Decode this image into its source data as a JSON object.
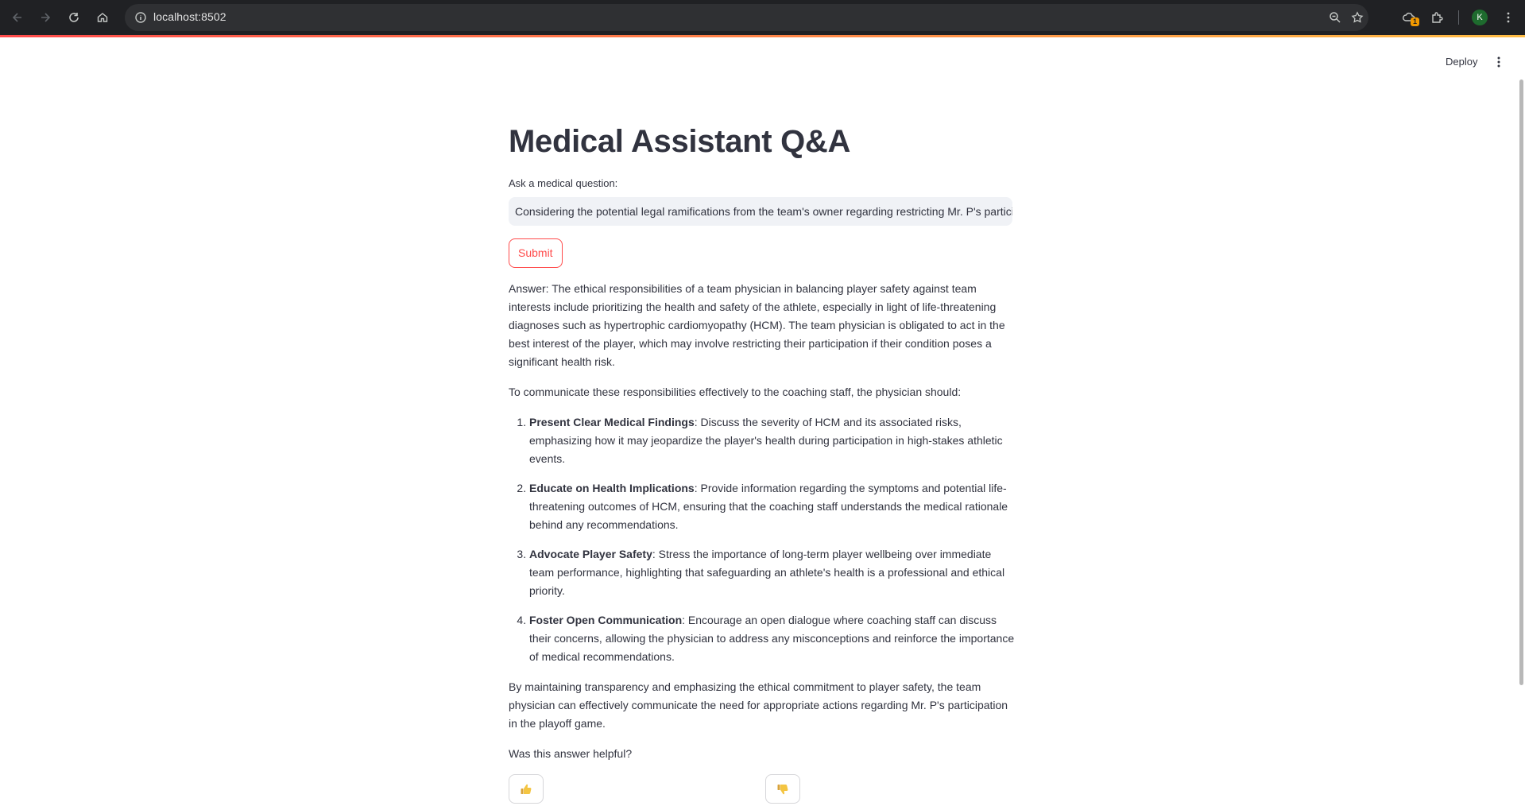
{
  "browser": {
    "url": "localhost:8502",
    "extension_badge": "1",
    "profile_initial": "K"
  },
  "header": {
    "deploy_label": "Deploy"
  },
  "main": {
    "title": "Medical Assistant Q&A",
    "question_label": "Ask a medical question:",
    "question_value": "Considering the potential legal ramifications from the team's owner regarding restricting Mr. P's participation in the playoff game, what are the ethical responsibilities of a team physician?",
    "submit_label": "Submit",
    "answer_intro": "Answer: The ethical responsibilities of a team physician in balancing player safety against team interests include prioritizing the health and safety of the athlete, especially in light of life-threatening diagnoses such as hypertrophic cardiomyopathy (HCM). The team physician is obligated to act in the best interest of the player, which may involve restricting their participation if their condition poses a significant health risk.",
    "answer_lead": "To communicate these responsibilities effectively to the coaching staff, the physician should:",
    "answer_items": [
      {
        "title": "Present Clear Medical Findings",
        "text": ": Discuss the severity of HCM and its associated risks, emphasizing how it may jeopardize the player's health during participation in high-stakes athletic events."
      },
      {
        "title": "Educate on Health Implications",
        "text": ": Provide information regarding the symptoms and potential life-threatening outcomes of HCM, ensuring that the coaching staff understands the medical rationale behind any recommendations."
      },
      {
        "title": "Advocate Player Safety",
        "text": ": Stress the importance of long-term player wellbeing over immediate team performance, highlighting that safeguarding an athlete's health is a professional and ethical priority."
      },
      {
        "title": "Foster Open Communication",
        "text": ": Encourage an open dialogue where coaching staff can discuss their concerns, allowing the physician to address any misconceptions and reinforce the importance of medical recommendations."
      }
    ],
    "answer_conclusion": "By maintaining transparency and emphasizing the ethical commitment to player safety, the team physician can effectively communicate the need for appropriate actions regarding Mr. P's participation in the playoff game.",
    "feedback_prompt": "Was this answer helpful?",
    "thumbs_up_icon": "thumbs-up-icon",
    "thumbs_down_icon": "thumbs-down-icon"
  },
  "colors": {
    "accent": "#ff4b4b",
    "text": "#31333f",
    "input_bg": "#f0f2f6",
    "chrome_bg": "#202124"
  }
}
